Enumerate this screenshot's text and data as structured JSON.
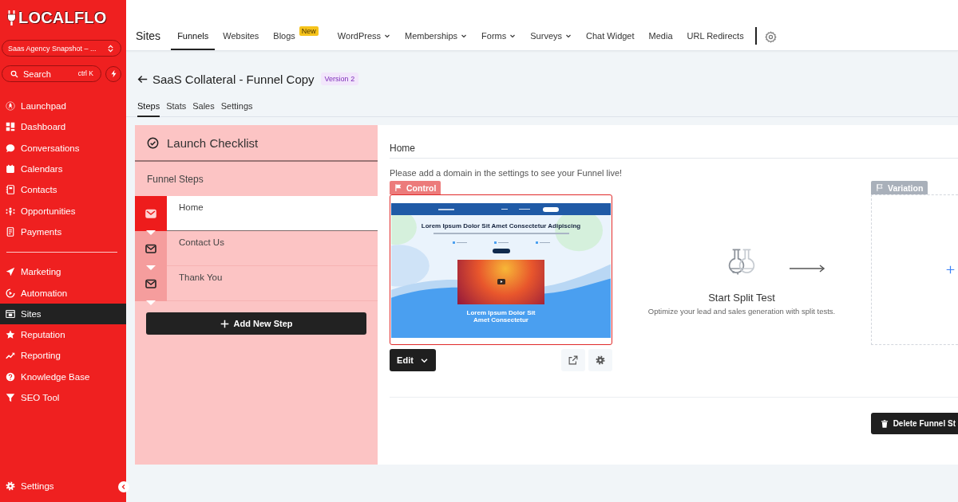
{
  "sidebar": {
    "logo": "LOCALFLO",
    "account": "Saas Agency Snapshot – ...",
    "search": {
      "placeholder": "Search",
      "shortcut": "ctrl K"
    },
    "nav_groups": [
      {
        "items": [
          {
            "label": "Launchpad",
            "selected": false
          },
          {
            "label": "Dashboard",
            "selected": false
          },
          {
            "label": "Conversations",
            "selected": false
          },
          {
            "label": "Calendars",
            "selected": false
          },
          {
            "label": "Contacts",
            "selected": false
          },
          {
            "label": "Opportunities",
            "selected": false
          },
          {
            "label": "Payments",
            "selected": false
          }
        ]
      },
      {
        "items": [
          {
            "label": "Marketing",
            "selected": false
          },
          {
            "label": "Automation",
            "selected": false
          },
          {
            "label": "Sites",
            "selected": true
          },
          {
            "label": "Reputation",
            "selected": false
          },
          {
            "label": "Reporting",
            "selected": false
          },
          {
            "label": "Knowledge Base",
            "selected": false
          },
          {
            "label": "SEO Tool",
            "selected": false
          }
        ]
      }
    ],
    "footer_item": {
      "label": "Settings",
      "selected": false
    }
  },
  "top_nav": {
    "title": "Sites",
    "tabs": [
      {
        "label": "Funnels",
        "selected": true,
        "dropdown": false
      },
      {
        "label": "Websites",
        "selected": false,
        "dropdown": false
      },
      {
        "label": "Blogs",
        "selected": false,
        "dropdown": false,
        "badge": "New"
      },
      {
        "label": "WordPress",
        "selected": false,
        "dropdown": true
      },
      {
        "label": "Memberships",
        "selected": false,
        "dropdown": true
      },
      {
        "label": "Forms",
        "selected": false,
        "dropdown": true
      },
      {
        "label": "Surveys",
        "selected": false,
        "dropdown": true
      },
      {
        "label": "Chat Widget",
        "selected": false,
        "dropdown": false
      },
      {
        "label": "Media",
        "selected": false,
        "dropdown": false
      },
      {
        "label": "URL Redirects",
        "selected": false,
        "dropdown": false
      }
    ]
  },
  "page_header": {
    "title": "SaaS Collateral - Funnel Copy",
    "version": "Version 2",
    "tabs": [
      {
        "label": "Steps",
        "selected": true
      },
      {
        "label": "Stats",
        "selected": false
      },
      {
        "label": "Sales",
        "selected": false
      },
      {
        "label": "Settings",
        "selected": false
      }
    ]
  },
  "steps_panel": {
    "checklist": "Launch Checklist",
    "heading": "Funnel Steps",
    "steps": [
      {
        "label": "Home",
        "selected": true
      },
      {
        "label": "Contact Us",
        "selected": false
      },
      {
        "label": "Thank You",
        "selected": false
      }
    ],
    "add_button": "Add New Step"
  },
  "step_detail": {
    "title": "Home",
    "notice": "Please add a domain in the settings to see your Funnel live!",
    "control": {
      "tag": "Control",
      "preview": {
        "headline": "Lorem Ipsum Dolor Sit Amet Consectetur Adipiscing",
        "footer_headline": "Lorem Ipsum Dolor Sit Amet Consectetur"
      },
      "edit_button": "Edit"
    },
    "split_test": {
      "title": "Start Split Test",
      "description": "Optimize your lead and sales generation with split tests."
    },
    "variation": {
      "tag": "Variation"
    },
    "delete_button": "Delete Funnel St"
  }
}
